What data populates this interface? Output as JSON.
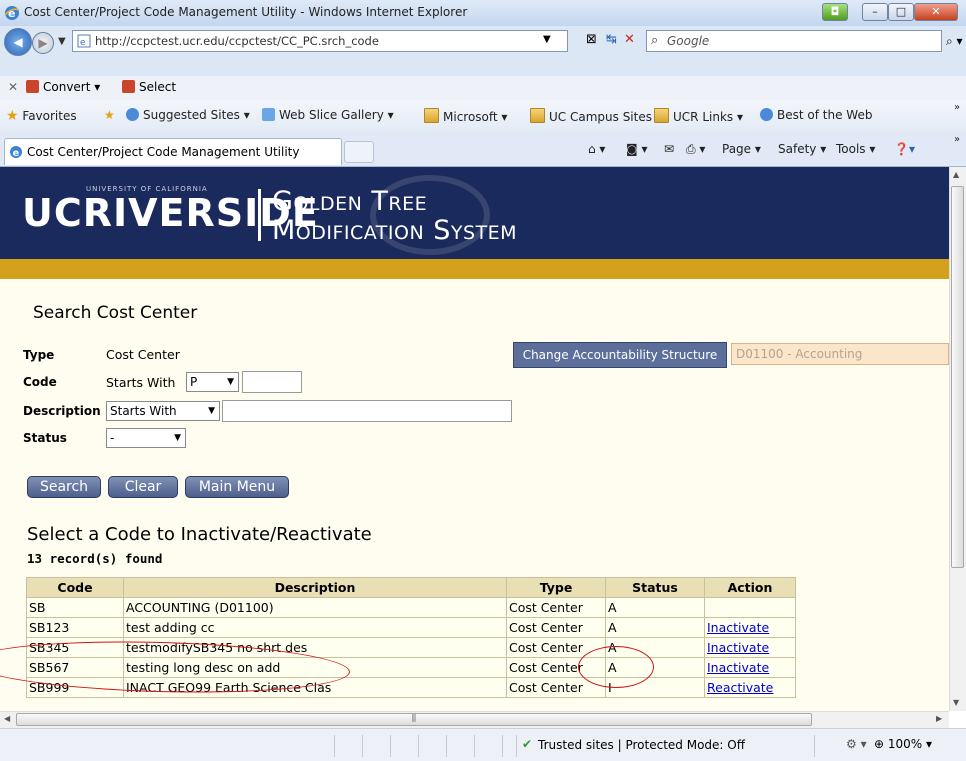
{
  "window": {
    "title": "Cost Center/Project Code Management Utility - Windows Internet Explorer"
  },
  "address_bar": {
    "url": "http://ccpctest.ucr.edu/ccpctest/CC_PC.srch_code",
    "search_placeholder": "Google"
  },
  "convert_bar": {
    "convert_label": "Convert",
    "select_label": "Select"
  },
  "favorites_bar": {
    "favorites_label": "Favorites",
    "items": [
      "Suggested Sites",
      "Web Slice Gallery",
      "Microsoft",
      "UC Campus Sites",
      "UCR Links",
      "Best of the Web"
    ]
  },
  "tab": {
    "title": "Cost Center/Project Code Management Utility"
  },
  "command_bar": {
    "page": "Page",
    "safety": "Safety",
    "tools": "Tools"
  },
  "banner": {
    "uc_text": "UCRIVERSIDE",
    "uoc_text": "UNIVERSITY OF CALIFORNIA",
    "line1": "Golden Tree",
    "line2": "Modification System"
  },
  "search_form": {
    "title": "Search Cost Center",
    "type_label": "Type",
    "type_value": "Cost Center",
    "code_label": "Code",
    "code_mode": "Starts With",
    "code_select_value": "P",
    "code_value": "",
    "description_label": "Description",
    "description_mode": "Starts With",
    "description_value": "",
    "status_label": "Status",
    "status_value": "-",
    "change_button": "Change Accountability Structure",
    "accountability_value": "D01100 - Accounting",
    "search_button": "Search",
    "clear_button": "Clear",
    "main_menu_button": "Main Menu"
  },
  "results": {
    "title": "Select a Code to Inactivate/Reactivate",
    "count": "13 record(s) found",
    "columns": [
      "Code",
      "Description",
      "Type",
      "Status",
      "Action"
    ],
    "rows": [
      {
        "code": "SB",
        "description": "ACCOUNTING (D01100)",
        "type": "Cost Center",
        "status": "A",
        "action": ""
      },
      {
        "code": "SB123",
        "description": "test adding cc",
        "type": "Cost Center",
        "status": "A",
        "action": "Inactivate"
      },
      {
        "code": "SB345",
        "description": "testmodifySB345 no shrt des",
        "type": "Cost Center",
        "status": "A",
        "action": "Inactivate"
      },
      {
        "code": "SB567",
        "description": "testing long desc on add",
        "type": "Cost Center",
        "status": "A",
        "action": "Inactivate"
      },
      {
        "code": "SB999",
        "description": "INACT GEO99 Earth Science Clas",
        "type": "Cost Center",
        "status": "I",
        "action": "Reactivate"
      }
    ]
  },
  "status_bar": {
    "zone": "Trusted sites | Protected Mode: Off",
    "zoom": "100%"
  }
}
